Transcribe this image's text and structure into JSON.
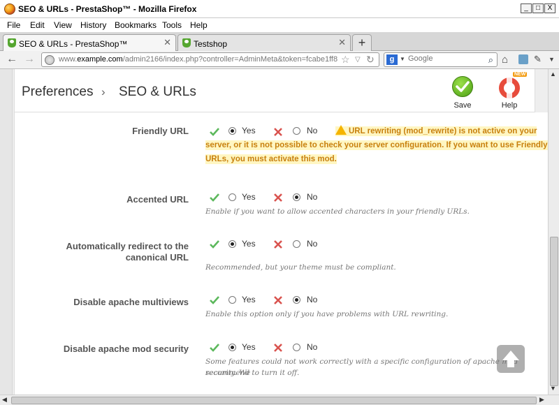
{
  "window": {
    "title": "SEO & URLs - PrestaShop™ - Mozilla Firefox",
    "controls": [
      "_",
      "□",
      "X"
    ]
  },
  "menu": [
    "File",
    "Edit",
    "View",
    "History",
    "Bookmarks",
    "Tools",
    "Help"
  ],
  "tabs": [
    {
      "label": "SEO & URLs - PrestaShop™",
      "active": true
    },
    {
      "label": "Testshop",
      "active": false
    }
  ],
  "address": {
    "prefix": "www.",
    "domain": "example.com",
    "path": "/admin2166/index.php?controller=AdminMeta&token=fcabe1ff8"
  },
  "search": {
    "placeholder": "Google",
    "engine_letter": "g"
  },
  "toolbar": {
    "breadcrumb_parent": "Preferences",
    "breadcrumb_sep": "›",
    "breadcrumb_current": "SEO & URLs",
    "save_label": "Save",
    "help_label": "Help",
    "help_badge": "NEW"
  },
  "options": {
    "yes": "Yes",
    "no": "No"
  },
  "fields": [
    {
      "label": "Friendly URL",
      "value": "yes",
      "warning": "URL rewriting (mod_rewrite) is not active on your server, or it is not possible to check your server configuration. If you want to use Friendly URLs, you must activate this mod."
    },
    {
      "label": "Accented URL",
      "value": "no",
      "help": "Enable if you want to allow accented characters in your friendly URLs."
    },
    {
      "label_line1": "Automatically redirect to the",
      "label_line2": "canonical URL",
      "value": "yes",
      "help": "Recommended, but your theme must be compliant."
    },
    {
      "label": "Disable apache multiviews",
      "value": "no",
      "help": "Enable this option only if you have problems with URL rewriting."
    },
    {
      "label": "Disable apache mod security",
      "value": "yes",
      "help_line1": "Some features could not work correctly with a specific configuration of apache mod security. We",
      "help_line2": "recommend to turn it off."
    }
  ],
  "colors": {
    "check": "#5cb85c",
    "cross": "#d9534f",
    "warning_text": "#c8800e",
    "warning_bg": "#fff6c2"
  }
}
